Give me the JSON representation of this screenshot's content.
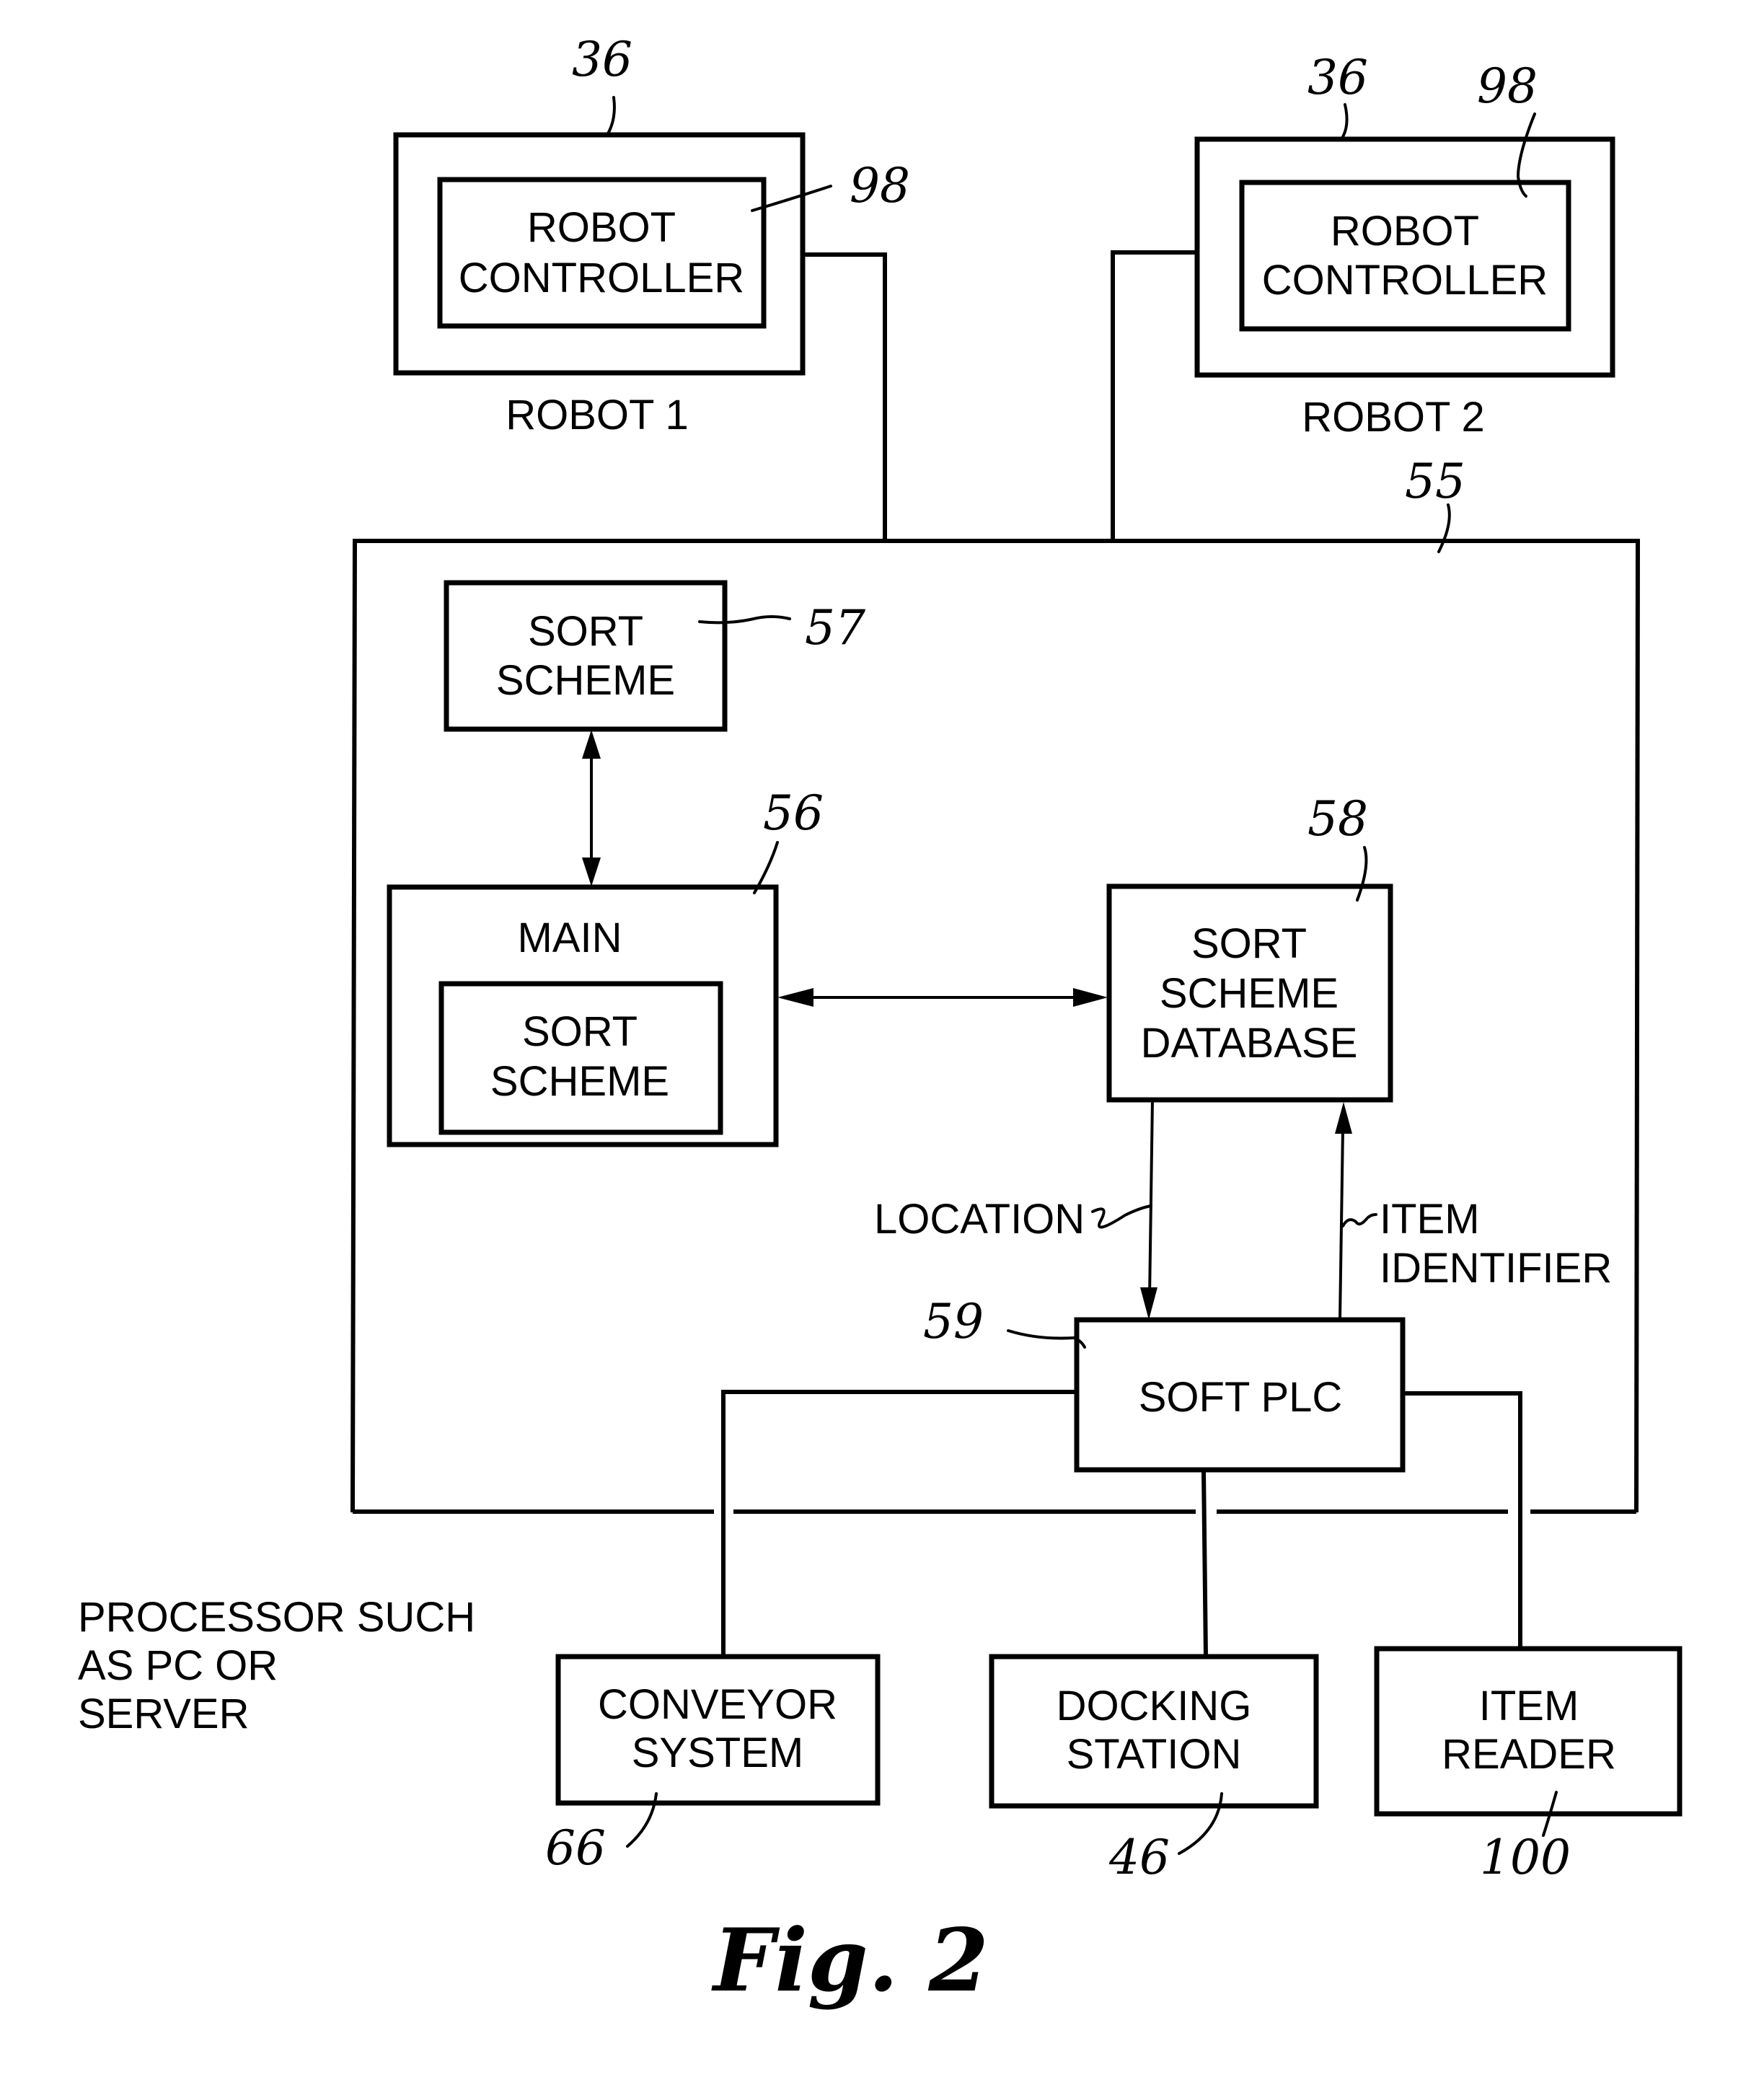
{
  "figure_label": "Fig. 2",
  "robots": [
    {
      "ref_outer": "36",
      "ref_inner": "98",
      "controller_lines": [
        "ROBOT",
        "CONTROLLER"
      ],
      "caption": "ROBOT 1"
    },
    {
      "ref_outer": "36",
      "ref_inner": "98",
      "controller_lines": [
        "ROBOT",
        "CONTROLLER"
      ],
      "caption": "ROBOT 2"
    }
  ],
  "processor": {
    "ref": "55",
    "caption_lines": [
      "PROCESSOR SUCH",
      "AS PC OR",
      "SERVER"
    ]
  },
  "sort_scheme": {
    "ref": "57",
    "lines": [
      "SORT",
      "SCHEME"
    ]
  },
  "main": {
    "ref": "56",
    "title": "MAIN",
    "inner_lines": [
      "SORT",
      "SCHEME"
    ]
  },
  "sort_scheme_database": {
    "ref": "58",
    "lines": [
      "SORT",
      "SCHEME",
      "DATABASE"
    ]
  },
  "soft_plc": {
    "ref": "59",
    "label": "SOFT PLC"
  },
  "flows": {
    "location": "LOCATION",
    "item_identifier_lines": [
      "ITEM",
      "IDENTIFIER"
    ]
  },
  "peripherals": [
    {
      "ref": "66",
      "lines": [
        "CONVEYOR",
        "SYSTEM"
      ]
    },
    {
      "ref": "46",
      "lines": [
        "DOCKING",
        "STATION"
      ]
    },
    {
      "ref": "100",
      "lines": [
        "ITEM",
        "READER"
      ]
    }
  ]
}
